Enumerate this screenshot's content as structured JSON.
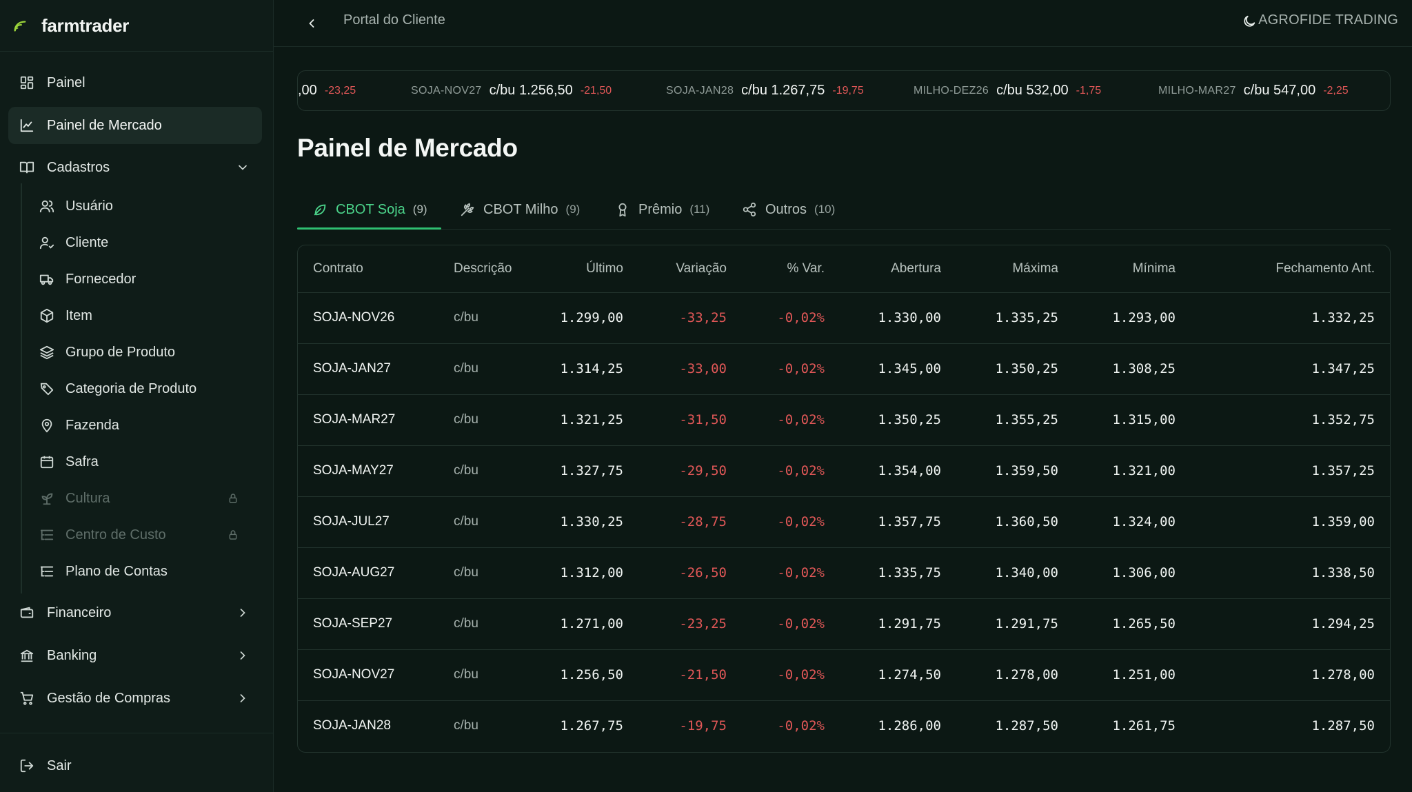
{
  "brand": {
    "name": "farmtrader"
  },
  "sidebar": {
    "items": [
      {
        "label": "Painel"
      },
      {
        "label": "Painel de Mercado"
      },
      {
        "label": "Cadastros"
      }
    ],
    "cadastros": [
      {
        "label": "Usuário"
      },
      {
        "label": "Cliente"
      },
      {
        "label": "Fornecedor"
      },
      {
        "label": "Item"
      },
      {
        "label": "Grupo de Produto"
      },
      {
        "label": "Categoria de Produto"
      },
      {
        "label": "Fazenda"
      },
      {
        "label": "Safra"
      },
      {
        "label": "Cultura"
      },
      {
        "label": "Centro de Custo"
      },
      {
        "label": "Plano de Contas"
      }
    ],
    "groups": [
      {
        "label": "Financeiro"
      },
      {
        "label": "Banking"
      },
      {
        "label": "Gestão de Compras"
      }
    ],
    "logout": "Sair"
  },
  "topbar": {
    "breadcrumb": "Portal do Cliente",
    "company": "AGROFIDE TRADING"
  },
  "ticker": [
    {
      "symbol": "",
      "price": ",00",
      "change": "-23,25"
    },
    {
      "symbol": "SOJA-NOV27",
      "price": "c/bu 1.256,50",
      "change": "-21,50"
    },
    {
      "symbol": "SOJA-JAN28",
      "price": "c/bu 1.267,75",
      "change": "-19,75"
    },
    {
      "symbol": "MILHO-DEZ26",
      "price": "c/bu 532,00",
      "change": "-1,75"
    },
    {
      "symbol": "MILHO-MAR27",
      "price": "c/bu 547,00",
      "change": "-2,25"
    }
  ],
  "page": {
    "title": "Painel de Mercado"
  },
  "tabs": [
    {
      "label": "CBOT Soja",
      "count": "(9)"
    },
    {
      "label": "CBOT Milho",
      "count": "(9)"
    },
    {
      "label": "Prêmio",
      "count": "(11)"
    },
    {
      "label": "Outros",
      "count": "(10)"
    }
  ],
  "table": {
    "headers": [
      "Contrato",
      "Descrição",
      "Último",
      "Variação",
      "% Var.",
      "Abertura",
      "Máxima",
      "Mínima",
      "Fechamento Ant."
    ],
    "rows": [
      [
        "SOJA-NOV26",
        "c/bu",
        "1.299,00",
        "-33,25",
        "-0,02%",
        "1.330,00",
        "1.335,25",
        "1.293,00",
        "1.332,25"
      ],
      [
        "SOJA-JAN27",
        "c/bu",
        "1.314,25",
        "-33,00",
        "-0,02%",
        "1.345,00",
        "1.350,25",
        "1.308,25",
        "1.347,25"
      ],
      [
        "SOJA-MAR27",
        "c/bu",
        "1.321,25",
        "-31,50",
        "-0,02%",
        "1.350,25",
        "1.355,25",
        "1.315,00",
        "1.352,75"
      ],
      [
        "SOJA-MAY27",
        "c/bu",
        "1.327,75",
        "-29,50",
        "-0,02%",
        "1.354,00",
        "1.359,50",
        "1.321,00",
        "1.357,25"
      ],
      [
        "SOJA-JUL27",
        "c/bu",
        "1.330,25",
        "-28,75",
        "-0,02%",
        "1.357,75",
        "1.360,50",
        "1.324,00",
        "1.359,00"
      ],
      [
        "SOJA-AUG27",
        "c/bu",
        "1.312,00",
        "-26,50",
        "-0,02%",
        "1.335,75",
        "1.340,00",
        "1.306,00",
        "1.338,50"
      ],
      [
        "SOJA-SEP27",
        "c/bu",
        "1.271,00",
        "-23,25",
        "-0,02%",
        "1.291,75",
        "1.291,75",
        "1.265,50",
        "1.294,25"
      ],
      [
        "SOJA-NOV27",
        "c/bu",
        "1.256,50",
        "-21,50",
        "-0,02%",
        "1.274,50",
        "1.278,00",
        "1.251,00",
        "1.278,00"
      ],
      [
        "SOJA-JAN28",
        "c/bu",
        "1.267,75",
        "-19,75",
        "-0,02%",
        "1.286,00",
        "1.287,50",
        "1.261,75",
        "1.287,50"
      ]
    ]
  },
  "colors": {
    "accent": "#2fbf71",
    "negative": "#e05757",
    "background": "#0c1814"
  }
}
